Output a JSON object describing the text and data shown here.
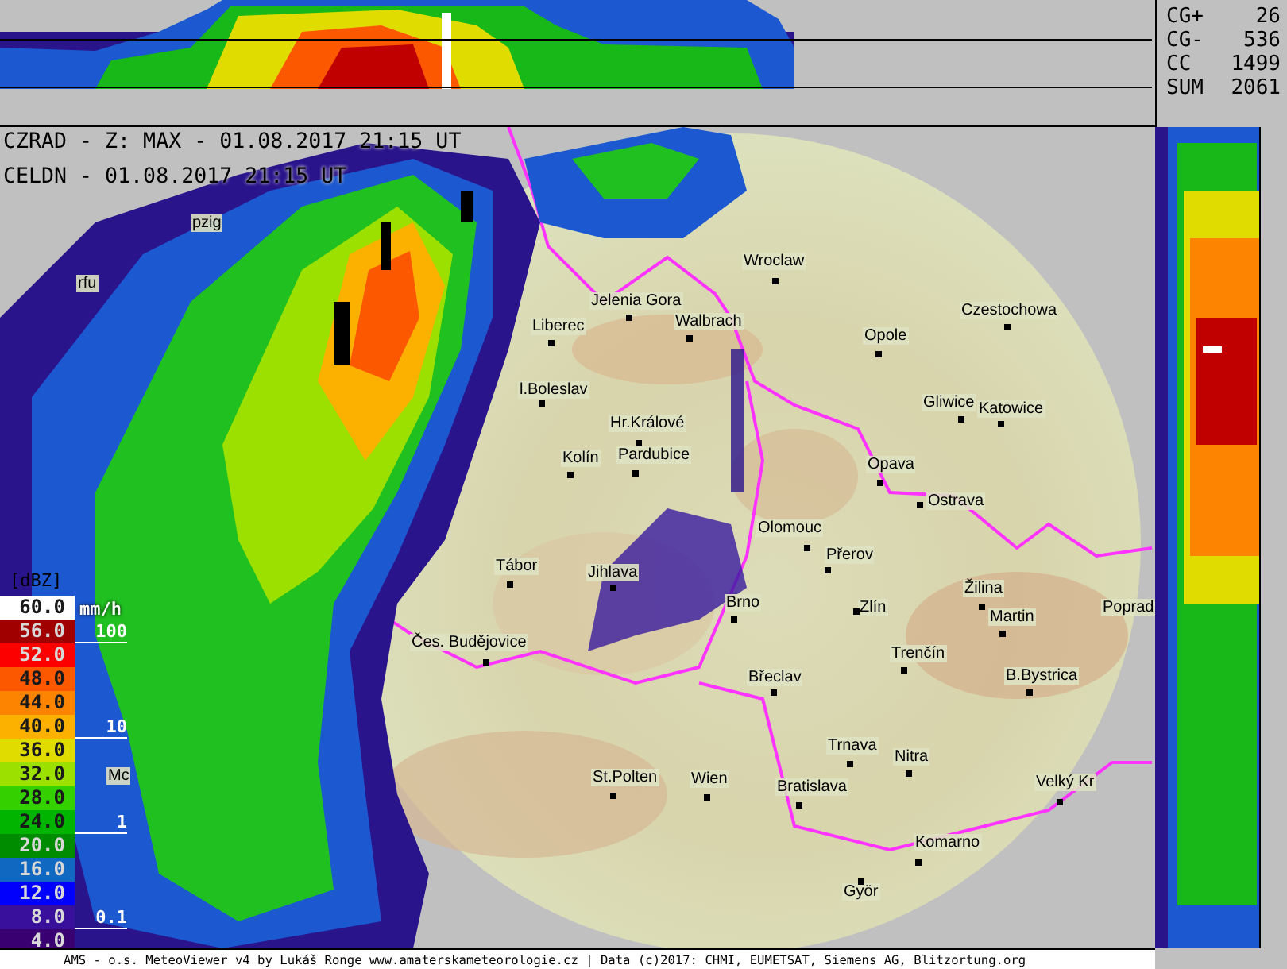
{
  "header_lines": [
    "CZRAD - Z: MAX - 01.08.2017 21:15 UT",
    "CELDN - 01.08.2017 21:15 UT"
  ],
  "lightning_stats": [
    {
      "label": "CG+",
      "value": "26"
    },
    {
      "label": "CG-",
      "value": "536"
    },
    {
      "label": "CC",
      "value": "1499"
    },
    {
      "label": "SUM",
      "value": "2061"
    }
  ],
  "cities": [
    "Wroclaw",
    "Jelenia Gora",
    "Walbrach",
    "Liberec",
    "Opole",
    "Czestochowa",
    "l.Boleslav",
    "Gliwice",
    "Katowice",
    "Hr.Králové",
    "Pardubice",
    "Kolín",
    "Opava",
    "Ostrava",
    "Olomouc",
    "Přerov",
    "Tábor",
    "Jihlava",
    "Brno",
    "Zlín",
    "Žilina",
    "Martin",
    "Poprad",
    "Čes. Budějovice",
    "Trenčín",
    "B.Bystrica",
    "Břeclav",
    "Trnava",
    "Nitra",
    "St.Polten",
    "Wien",
    "Bratislava",
    "Velký Kr",
    "Komarno",
    "Györ",
    "pzig",
    "rfu",
    "Mc"
  ],
  "legend": {
    "unit": "[dBZ]",
    "rate_unit": "mm/h",
    "levels": [
      {
        "label": "60.0",
        "color": "#ffffff"
      },
      {
        "label": "56.0",
        "color": "#a00000"
      },
      {
        "label": "52.0",
        "color": "#fc0000"
      },
      {
        "label": "48.0",
        "color": "#fc5800"
      },
      {
        "label": "44.0",
        "color": "#fc8400"
      },
      {
        "label": "40.0",
        "color": "#fcb000"
      },
      {
        "label": "36.0",
        "color": "#e0dc00"
      },
      {
        "label": "32.0",
        "color": "#9ce000"
      },
      {
        "label": "28.0",
        "color": "#34d000"
      },
      {
        "label": "24.0",
        "color": "#00b400"
      },
      {
        "label": "20.0",
        "color": "#008c00"
      },
      {
        "label": "16.0",
        "color": "#1068c0"
      },
      {
        "label": "12.0",
        "color": "#0000fc"
      },
      {
        "label": "8.0",
        "color": "#38109c"
      },
      {
        "label": "4.0",
        "color": "#380070"
      }
    ],
    "rates": [
      "100",
      "10",
      "1",
      "0.1"
    ]
  },
  "footer": "AMS - o.s. MeteoViewer v4 by Lukáš Ronge www.amaterskameteorologie.cz | Data (c)2017: CHMI, EUMETSAT, Siemens AG, Blitzortung.org"
}
